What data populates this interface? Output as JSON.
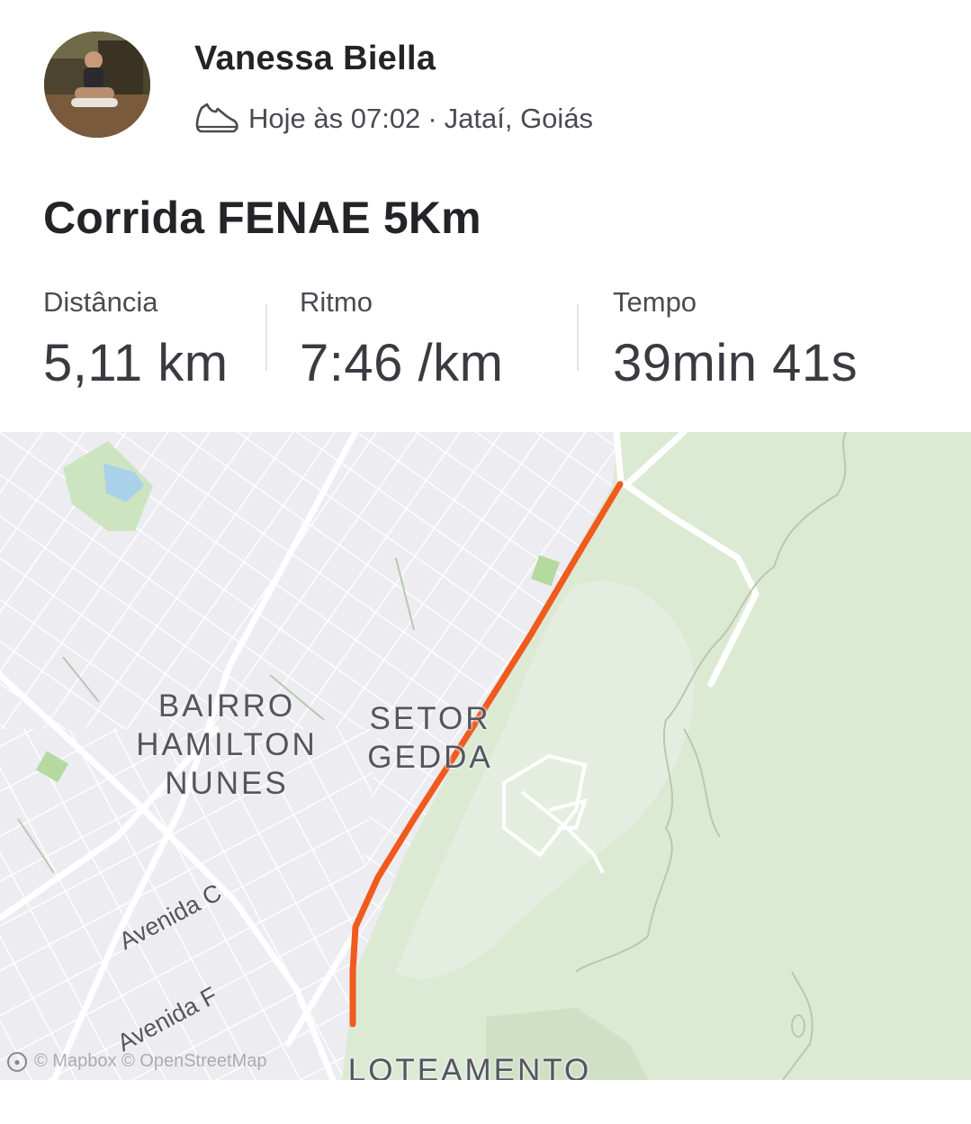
{
  "athlete": {
    "name": "Vanessa Biella",
    "avatar_icon": "profile-photo"
  },
  "activity": {
    "sport_icon": "running-shoe-icon",
    "time": "Hoje às 07:02",
    "separator": "·",
    "location": "Jataí, Goiás",
    "title": "Corrida FENAE 5Km"
  },
  "stats": [
    {
      "label": "Distância",
      "value": "5,11 km"
    },
    {
      "label": "Ritmo",
      "value": "7:46 /km"
    },
    {
      "label": "Tempo",
      "value": "39min 41s"
    }
  ],
  "map": {
    "route_color": "#fc4c02",
    "areas": {
      "bairro": "BAIRRO\nHAMILTON\nNUNES",
      "setor": "SETOR\nGEDDA",
      "loteamento": "LOTEAMENTO"
    },
    "streets": {
      "avenida_c": "Avenida C",
      "avenida_f": "Avenida F"
    },
    "attribution": "© Mapbox © OpenStreetMap"
  }
}
